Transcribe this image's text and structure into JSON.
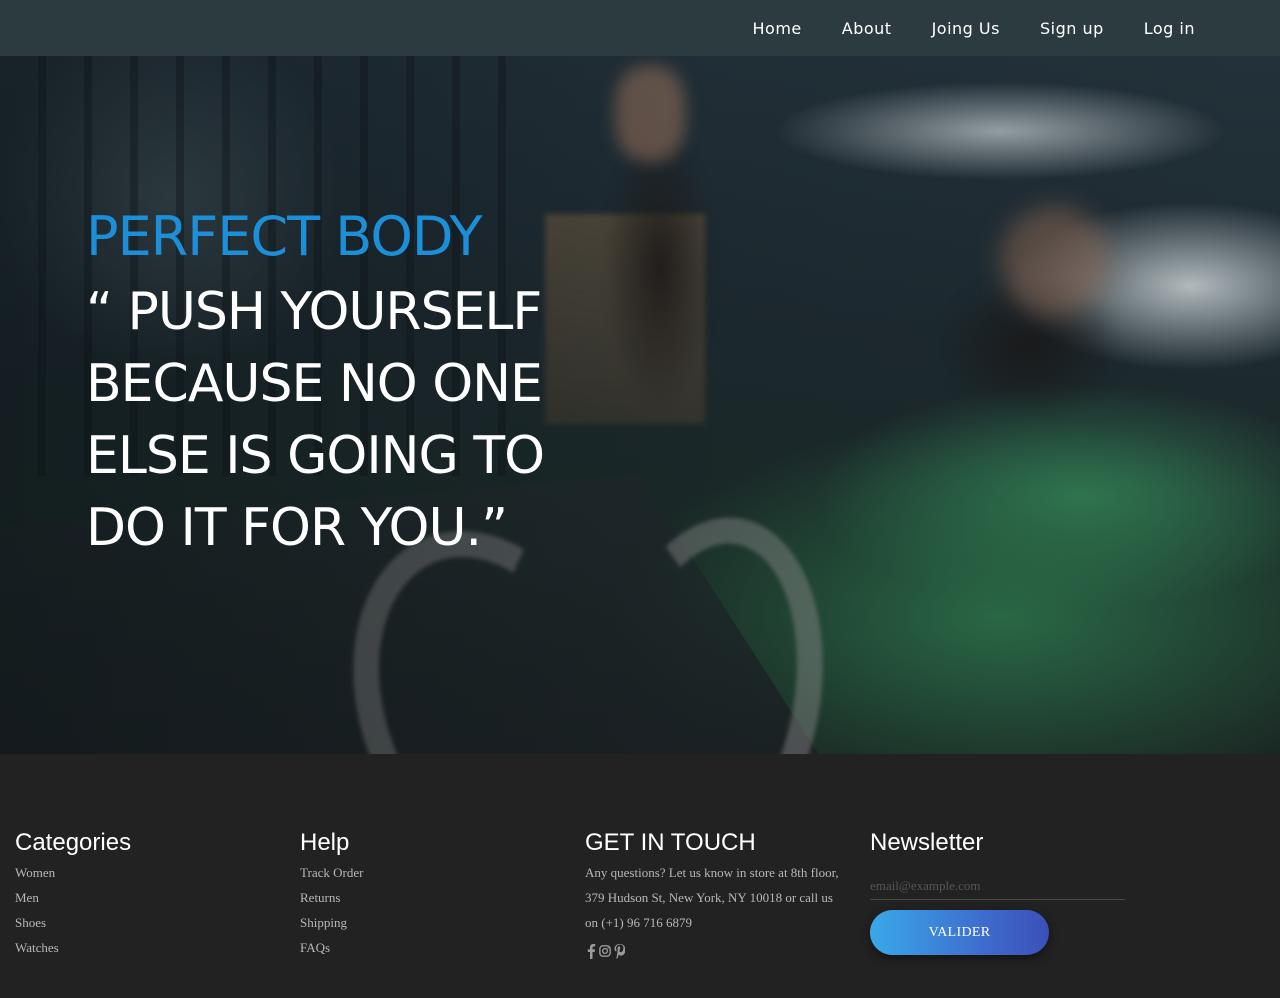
{
  "nav": {
    "items": [
      {
        "label": "Home"
      },
      {
        "label": "About"
      },
      {
        "label": "Joing Us"
      },
      {
        "label": "Sign up"
      },
      {
        "label": "Log in"
      }
    ]
  },
  "hero": {
    "title": "PERFECT BODY",
    "quote_lines": [
      "“ PUSH YOURSELF",
      "BECAUSE NO ONE",
      "ELSE IS GOING TO",
      "DO IT FOR YOU.”"
    ]
  },
  "footer": {
    "categories": {
      "heading": "Categories",
      "items": [
        "Women",
        "Men",
        "Shoes",
        "Watches"
      ]
    },
    "help": {
      "heading": "Help",
      "items": [
        "Track Order",
        "Returns",
        "Shipping",
        "FAQs"
      ]
    },
    "contact": {
      "heading": "GET IN TOUCH",
      "text": "Any questions? Let us know in store at 8th floor, 379 Hudson St, New York, NY 10018 or call us on (+1) 96 716 6879",
      "social_icons": [
        "facebook-icon",
        "instagram-icon",
        "pinterest-icon"
      ]
    },
    "newsletter": {
      "heading": "Newsletter",
      "placeholder": "email@example.com",
      "value": "",
      "button_label": "VALIDER"
    }
  },
  "colors": {
    "navbar_bg": "#2b3b3f",
    "hero_title": "#1d8ed8",
    "footer_bg": "#222222",
    "button_gradient_start": "#3aa8e8",
    "button_gradient_end": "#3c4fb8"
  }
}
